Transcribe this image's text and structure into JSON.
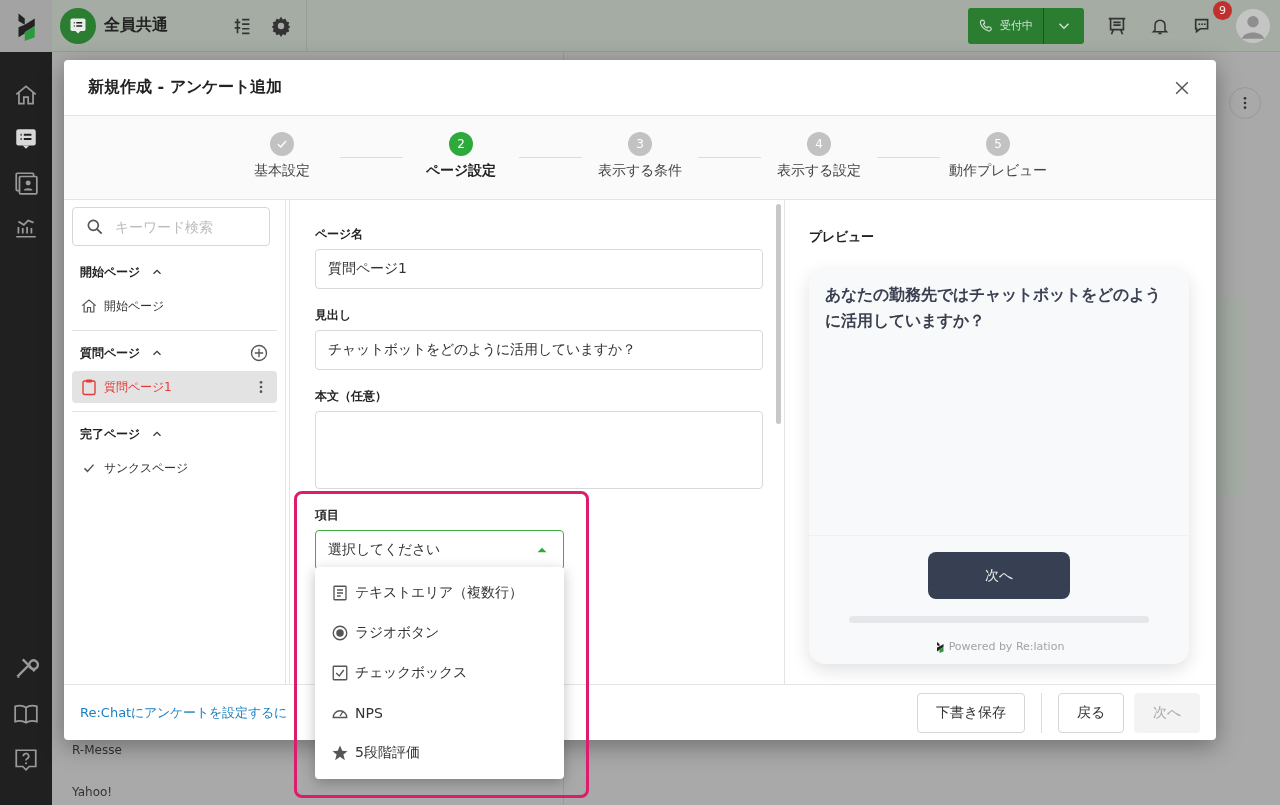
{
  "app_bar": {
    "workspace": "全員共通",
    "status_button": "受付中",
    "badge": "9"
  },
  "background_list": [
    "R-Messe",
    "Yahoo!"
  ],
  "dialog": {
    "title": "新規作成 - アンケート追加",
    "steps": [
      {
        "label": "基本設定",
        "completed": true,
        "selected": false
      },
      {
        "number": "2",
        "label": "ページ設定",
        "completed": false,
        "selected": true
      },
      {
        "number": "3",
        "label": "表示する条件",
        "completed": false,
        "selected": false
      },
      {
        "number": "4",
        "label": "表示する設定",
        "completed": false,
        "selected": false
      },
      {
        "number": "5",
        "label": "動作プレビュー",
        "completed": false,
        "selected": false
      }
    ],
    "search": {
      "placeholder": "キーワード検索"
    },
    "page_groups": [
      {
        "title": "開始ページ",
        "expanded": true,
        "add_button": false,
        "items": [
          {
            "label": "開始ページ",
            "kind": "home",
            "selected": false
          }
        ]
      },
      {
        "title": "質問ページ",
        "expanded": true,
        "add_button": true,
        "items": [
          {
            "label": "質問ページ1",
            "kind": "question",
            "selected": true
          }
        ]
      },
      {
        "title": "完了ページ",
        "expanded": true,
        "add_button": false,
        "items": [
          {
            "label": "サンクスページ",
            "kind": "thanks",
            "selected": false
          }
        ]
      }
    ],
    "form": {
      "fields": [
        {
          "label": "ページ名",
          "kind": "input",
          "value": "質問ページ1"
        },
        {
          "label": "見出し",
          "kind": "input",
          "value": "チャットボットをどのように活用していますか？"
        },
        {
          "label": "本文（任意）",
          "kind": "textarea"
        }
      ],
      "item_select": {
        "label": "項目",
        "prompt": "選択してください",
        "expanded": true,
        "options": [
          {
            "label": "テキストエリア（複数行）",
            "kind": "textarea"
          },
          {
            "label": "ラジオボタン",
            "kind": "radio"
          },
          {
            "label": "チェックボックス",
            "kind": "checkbox"
          },
          {
            "label": "NPS",
            "kind": "nps"
          },
          {
            "label": "5段階評価",
            "kind": "rating"
          }
        ]
      }
    },
    "preview": {
      "title": "プレビュー",
      "question": "あなたの勤務先ではチャットボットをどのように活用していますか？",
      "next_button": "次へ",
      "footer": "Powered by Re:lation"
    },
    "footer": {
      "help_link": "Re:Chatにアンケートを設定するに",
      "buttons": [
        {
          "label": "下書き保存",
          "disabled": false
        },
        {
          "label": "戻る",
          "disabled": false
        },
        {
          "label": "次へ",
          "disabled": true
        }
      ]
    }
  }
}
